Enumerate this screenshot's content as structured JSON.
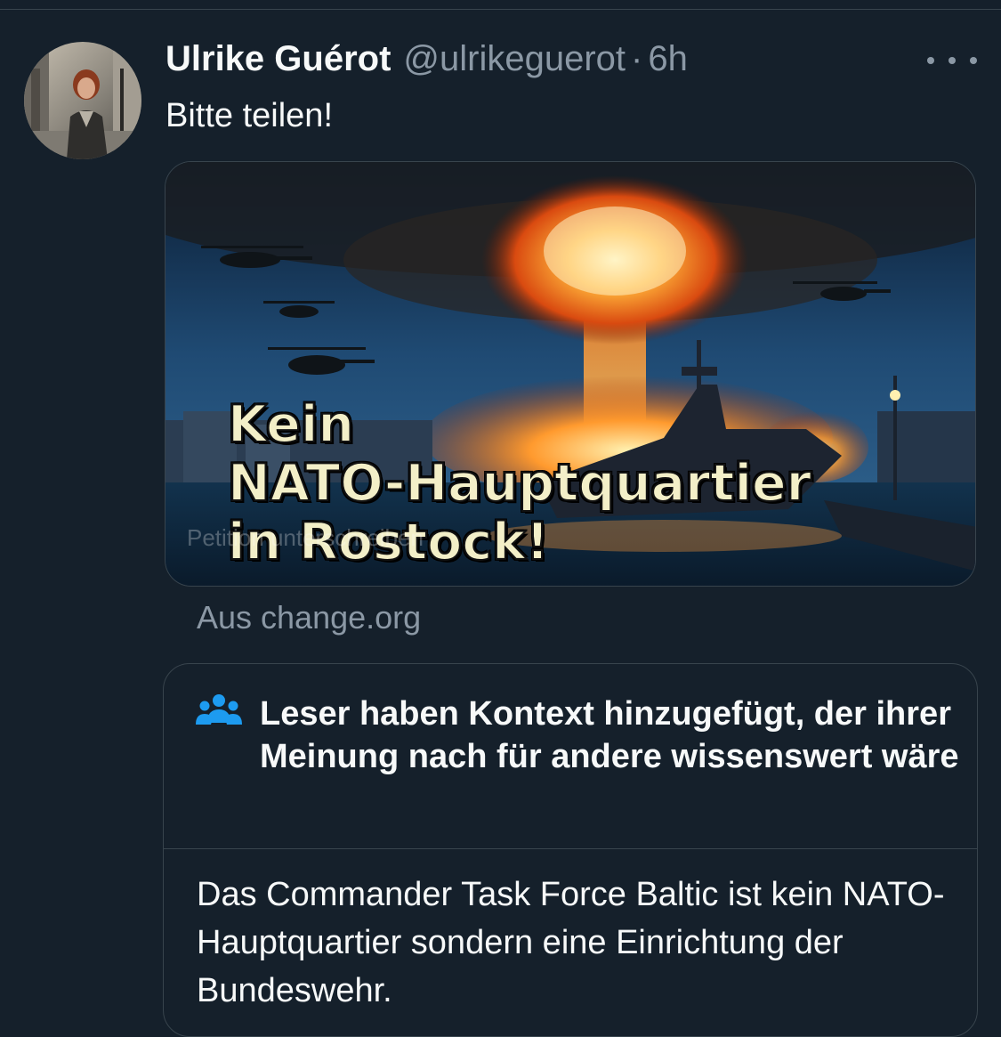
{
  "tweet": {
    "author_name": "Ulrike Guérot",
    "handle": "@ulrikeguerot",
    "separator": "·",
    "time": "6h",
    "text": "Bitte teilen!",
    "more_icon": "more-horizontal-icon"
  },
  "media": {
    "overlay_lines": [
      "Kein",
      "NATO-Hauptquartier",
      "in Rostock!"
    ],
    "faint_text": "Petition unterschreiben",
    "source": "Aus change.org"
  },
  "context_note": {
    "icon": "community-people-icon",
    "title": "Leser haben Kontext hinzugefügt, der ihrer Meinung nach für andere wissenswert wäre",
    "body": "Das Commander Task Force Baltic ist kein NATO-Hauptquartier sondern eine Einrichtung der Bundeswehr."
  },
  "colors": {
    "background": "#15202b",
    "secondary_text": "#8b98a5",
    "border": "#38444d",
    "note_icon": "#1d9bf0"
  }
}
